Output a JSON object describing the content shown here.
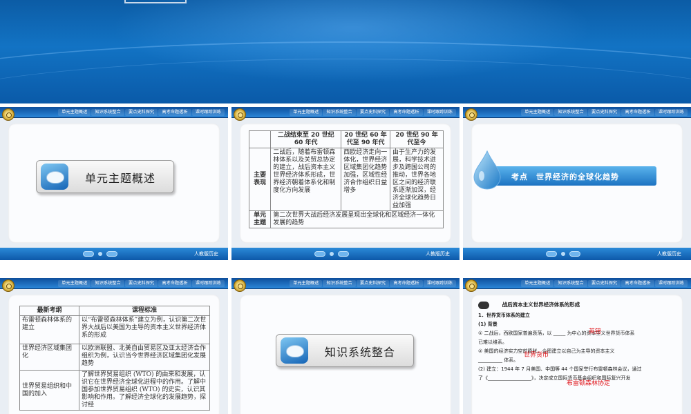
{
  "nav": [
    "单元主题概述",
    "知识系统整合",
    "要点史料探究",
    "高考命题透析",
    "课时跟踪训练"
  ],
  "publisher": "人教版历史",
  "slide1": {
    "title": "单元主题概述"
  },
  "slide2": {
    "headers": [
      "",
      "二战结束至 20 世纪 60 年代",
      "20 世纪 60 年代至 90 年代",
      "20 世纪 90 年代至今"
    ],
    "row1_label": "主要表现",
    "row1_cells": [
      "二战后，随着布雷顿森林体系以及关贸总协定的建立，战后资本主义世界经济体系形成，世界经济朝着体系化和制度化方向发展",
      "西欧经济走向一体化，世界经济区域集团化趋势加强，区域性经济合作组织日益增多",
      "由于生产力的发展，科学技术进步及跨国公司的推动，世界各地区之间的经济联系逐渐加深，经济全球化趋势日益加强"
    ],
    "row2_label": "单元主题",
    "row2_text": "第二次世界大战后经济发展呈现出全球化和区域经济一体化发展的趋势"
  },
  "slide3": {
    "banner": "考点　世界经济的全球化趋势"
  },
  "slide4": {
    "headers": [
      "最新考纲",
      "课程标准"
    ],
    "rows": [
      {
        "topic": "布雷顿森林体系的建立",
        "text": "以“布雷顿森林体系”建立为例，认识第二次世界大战后以美国为主导的资本主义世界经济体系的形成"
      },
      {
        "topic": "世界经济区域集团化",
        "text": "以欧洲联盟、北美自由贸易区及亚太经济合作组织为例，认识当今世界经济区域集团化发展趋势"
      },
      {
        "topic": "世界贸易组织和中国的加入",
        "text": "了解世界贸易组织 (WTO) 的由来和发展，认识它在世界经济全球化进程中的作用。了解中国参加世界贸易组织 (WTO) 的史实，认识其影响和作用。了解经济全球化的发展趋势，探讨经"
      }
    ]
  },
  "slide5": {
    "title": "知识系统整合"
  },
  "slide6": {
    "heading": "战后资本主义世界经济体系的形成",
    "sub1": "1．世界货币体系的建立",
    "bg": "(1) 背景",
    "p1a": "① 二战后，西欧国家普遍衰落，以 _____ 为中心的资本主义世界货币体系",
    "p1b": "已难以维系。",
    "p2a": "② 美国的经济实力空前膨胀，企图建立以自己为主导的资本主义",
    "p2b": "__________ 体系。",
    "p3a": "(2) 建立：1944 年 7 月美国、中国等 44 个国家举行布雷顿森林会议，通过",
    "p3b": "了《__________________》，决定成立国际货币基金组织和国际复兴开发",
    "ans1": "英镑",
    "ans2": "世界货币",
    "ans3": "布雷顿森林协定"
  }
}
